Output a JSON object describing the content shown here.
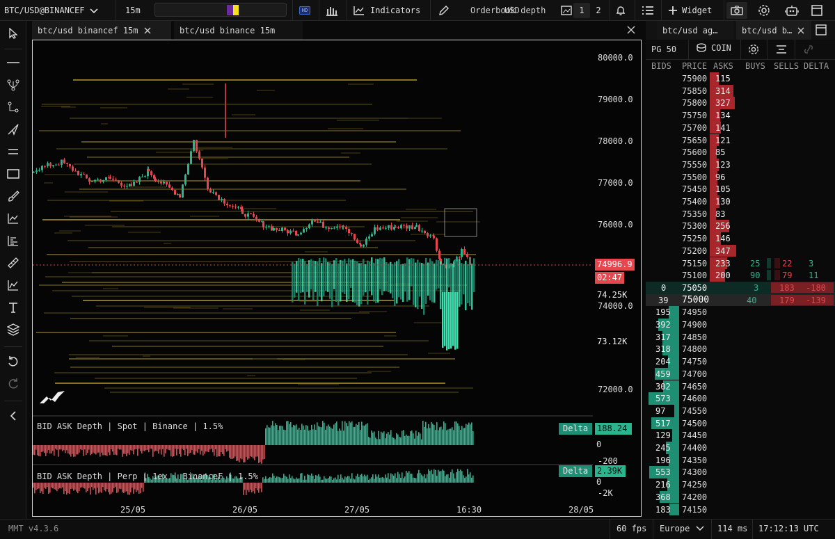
{
  "toolbar": {
    "symbol": "BTC/USD@BINANCEF",
    "interval": "15m",
    "hd_badge": "HD",
    "indicators_label": "Indicators",
    "orderbook_label": "Orderbook depth",
    "usd_label": "USD",
    "layout_1": "1",
    "layout_2": "2",
    "widget_label": "Widget"
  },
  "tabs": {
    "chart_tab_1": "btc/usd binancef 15m",
    "chart_tab_2": "btc/usd binance 15m",
    "ob_tab_1": "btc/usd ag…",
    "ob_tab_2": "btc/usd b…"
  },
  "chart": {
    "price_axis": [
      "80000.0",
      "79000.0",
      "78000.0",
      "77000.0",
      "76000.0",
      "74000.0",
      "72000.0"
    ],
    "current_price": "74996.9",
    "countdown": "02:47",
    "volume_label_1": "74.25K",
    "volume_label_2": "73.12K",
    "time_axis": [
      "25/05",
      "26/05",
      "27/05",
      "16:30",
      "28/05"
    ],
    "panel1_title": "BID ASK Depth | Spot | Binance | 1.5%",
    "panel1_delta_label": "Delta",
    "panel1_delta_value": "188.24",
    "panel1_zero": "0",
    "panel1_min": "-200",
    "panel2_title": "BID ASK Depth | Perp | 1ex | BinanceF | 1.5%",
    "panel2_delta_label": "Delta",
    "panel2_delta_value": "2.39K",
    "panel2_zero": "0",
    "panel2_min": "-2K"
  },
  "orderbook": {
    "pg_label": "PG 50",
    "coin_label": "COIN",
    "headers": [
      "BIDS",
      "PRICE",
      "ASKS",
      "BUYS",
      "SELLS",
      "DELTA"
    ],
    "asks": [
      {
        "price": "75900",
        "size": "115",
        "level": 0.33
      },
      {
        "price": "75850",
        "size": "314",
        "level": 0.9
      },
      {
        "price": "75800",
        "size": "327",
        "level": 0.94
      },
      {
        "price": "75750",
        "size": "134",
        "level": 0.39
      },
      {
        "price": "75700",
        "size": "141",
        "level": 0.41
      },
      {
        "price": "75650",
        "size": "121",
        "level": 0.35
      },
      {
        "price": "75600",
        "size": "85",
        "level": 0.25
      },
      {
        "price": "75550",
        "size": "123",
        "level": 0.35
      },
      {
        "price": "75500",
        "size": "96",
        "level": 0.28
      },
      {
        "price": "75450",
        "size": "105",
        "level": 0.3
      },
      {
        "price": "75400",
        "size": "130",
        "level": 0.37
      },
      {
        "price": "75350",
        "size": "83",
        "level": 0.24
      },
      {
        "price": "75300",
        "size": "256",
        "level": 0.74
      },
      {
        "price": "75250",
        "size": "146",
        "level": 0.42
      },
      {
        "price": "75200",
        "size": "347",
        "level": 1.0
      },
      {
        "price": "75150",
        "size": "233",
        "level": 0.67,
        "buys": "25",
        "sells": "22",
        "delta": "3"
      },
      {
        "price": "75100",
        "size": "200",
        "level": 0.58,
        "buys": "90",
        "sells": "79",
        "delta": "11"
      }
    ],
    "mid": [
      {
        "bid": "0",
        "price": "75050",
        "buys": "3",
        "sells": "183",
        "delta": "-180"
      },
      {
        "bid": "39",
        "price": "75000",
        "buys": "40",
        "sells": "179",
        "delta": "-139"
      }
    ],
    "bids": [
      {
        "price": "74950",
        "size": "195",
        "level": 0.34
      },
      {
        "price": "74900",
        "size": "392",
        "level": 0.68
      },
      {
        "price": "74850",
        "size": "317",
        "level": 0.55
      },
      {
        "price": "74800",
        "size": "318",
        "level": 0.55
      },
      {
        "price": "74750",
        "size": "204",
        "level": 0.36
      },
      {
        "price": "74700",
        "size": "459",
        "level": 0.8
      },
      {
        "price": "74650",
        "size": "302",
        "level": 0.53
      },
      {
        "price": "74600",
        "size": "573",
        "level": 1.0
      },
      {
        "price": "74550",
        "size": "97",
        "level": 0.17
      },
      {
        "price": "74500",
        "size": "517",
        "level": 0.9
      },
      {
        "price": "74450",
        "size": "129",
        "level": 0.23
      },
      {
        "price": "74400",
        "size": "245",
        "level": 0.43
      },
      {
        "price": "74350",
        "size": "196",
        "level": 0.34
      },
      {
        "price": "74300",
        "size": "553",
        "level": 0.97
      },
      {
        "price": "74250",
        "size": "216",
        "level": 0.38
      },
      {
        "price": "74200",
        "size": "368",
        "level": 0.64
      },
      {
        "price": "74150",
        "size": "183",
        "level": 0.32
      }
    ]
  },
  "status": {
    "version": "MMT v4.3.6",
    "fps": "60 fps",
    "region": "Europe",
    "latency": "114 ms",
    "clock": "17:12:13 UTC"
  },
  "colors": {
    "bid": "#2bb58f",
    "ask": "#d9474e",
    "accent": "#3b6fe0",
    "orderbook_line": "#c7ae2a"
  }
}
